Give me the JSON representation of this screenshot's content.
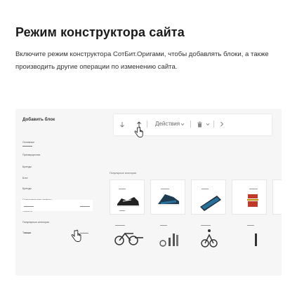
{
  "title": "Режим конструктора сайта",
  "description": "Включите режим конструктора СотБит.Оригами, чтобы добавлять блоки, а также производить другие операции по изменению сайта.",
  "panel": {
    "title": "Добавить блок",
    "sidebar": {
      "items": [
        {
          "label": "Основные"
        },
        {
          "label": "Преимущества"
        },
        {
          "label": "Бренды"
        },
        {
          "label": "Блог"
        },
        {
          "label": "Бренды"
        },
        {
          "label": "Сопутствующие сервисы"
        },
        {
          "label": "Новости"
        },
        {
          "label": "Популярные категории"
        },
        {
          "label": "Товары"
        }
      ]
    },
    "toolbar": {
      "actions_label": "Действия",
      "icons": [
        "arrow-down-icon",
        "arrow-up-icon",
        "chevron-down-icon",
        "trash-icon",
        "chevron-down-icon",
        "chevron-right-icon"
      ]
    },
    "canvas": {
      "section_label": "Популярные категории"
    }
  },
  "colors": {
    "accent": "#c0392b",
    "blue_accent": "#2a6f97",
    "panel_bg": "#f6f6f6"
  }
}
